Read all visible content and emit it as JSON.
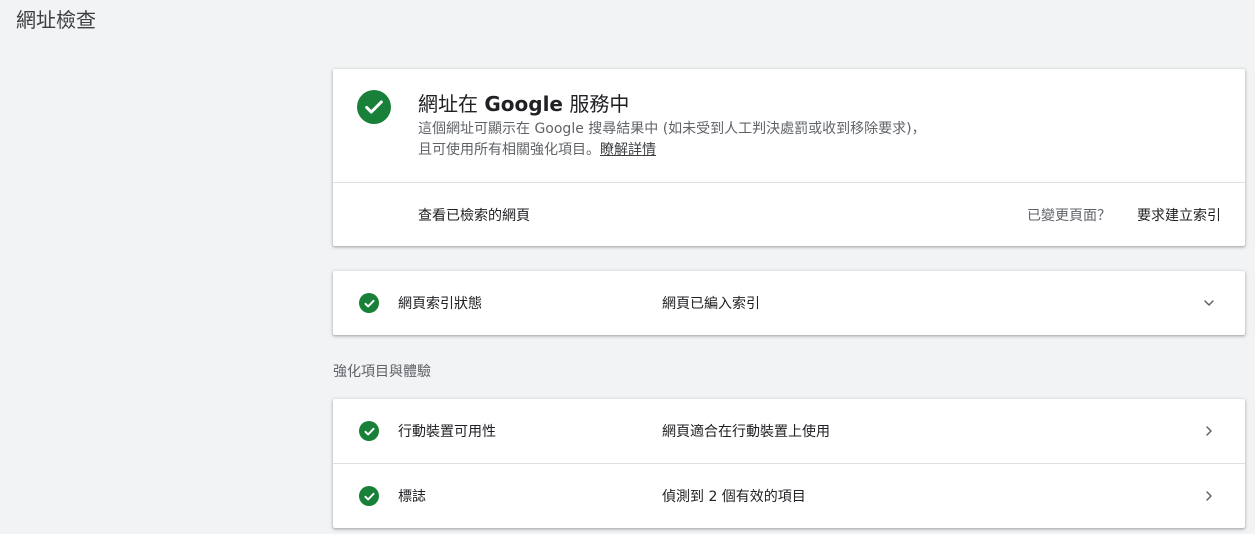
{
  "header": {
    "title": "網址檢查"
  },
  "status_card": {
    "heading_pre": "網址在 ",
    "heading_brand": "Google",
    "heading_post": " 服務中",
    "desc_line1": "這個網址可顯示在 Google 搜尋結果中 (如未受到人工判決處罰或收到移除要求)，",
    "desc_line2": "且可使用所有相關強化項目。",
    "learn_more": "瞭解詳情",
    "view_crawled_page": "查看已檢索的網頁",
    "page_changed": "已變更頁面？",
    "request_indexing": "要求建立索引",
    "check_icon": "check-circle-icon",
    "status_color": "#188038"
  },
  "index_card": {
    "label": "網頁索引狀態",
    "value": "網頁已編入索引",
    "chevron_icon": "chevron-down-icon"
  },
  "enhancements": {
    "title": "強化項目與體驗",
    "items": [
      {
        "label": "行動裝置可用性",
        "value": "網頁適合在行動裝置上使用",
        "chevron_icon": "chevron-right-icon"
      },
      {
        "label": "標誌",
        "value": "偵測到 2 個有效的項目",
        "chevron_icon": "chevron-right-icon"
      }
    ]
  }
}
